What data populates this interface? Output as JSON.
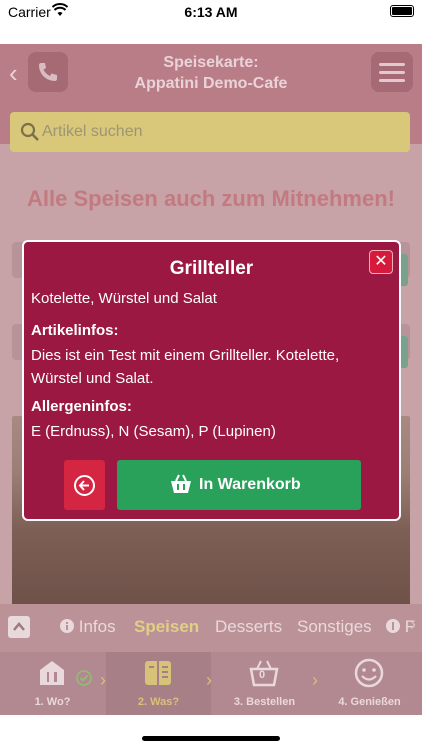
{
  "status_bar": {
    "carrier": "Carrier",
    "time": "6:13 AM"
  },
  "header": {
    "title_line1": "Speisekarte:",
    "title_line2": "Appatini Demo-Cafe"
  },
  "search": {
    "placeholder": "Artikel suchen"
  },
  "banner": {
    "text": "Alle Speisen auch zum Mitnehmen!"
  },
  "tabs": [
    {
      "label": "Infos",
      "active": false
    },
    {
      "label": "Speisen",
      "active": true
    },
    {
      "label": "Desserts",
      "active": false
    },
    {
      "label": "Sonstiges",
      "active": false
    },
    {
      "label": "F",
      "active": false
    }
  ],
  "steps": [
    {
      "label": "1. Wo?",
      "icon": "restaurant-icon"
    },
    {
      "label": "2. Was?",
      "icon": "menu-book-icon"
    },
    {
      "label": "3. Bestellen",
      "icon": "basket-icon",
      "badge": "0"
    },
    {
      "label": "4. Genießen",
      "icon": "smiley-icon"
    }
  ],
  "modal": {
    "title": "Grillteller",
    "subtitle": "Kotelette, Würstel und Salat",
    "info_heading": "Artikelinfos:",
    "info_text": "Dies ist ein Test mit einem Grillteller. Kotelette, Würstel und Salat.",
    "allergen_heading": "Allergeninfos:",
    "allergen_text": "E (Erdnuss), N (Sesam), P (Lupinen)",
    "close_label": "✕",
    "cart_button_label": "In Warenkorb"
  },
  "colors": {
    "modal_bg": "#9b1843",
    "cart_button": "#2aa15a",
    "back_button": "#d42542",
    "active_accent": "#d7c27a"
  }
}
